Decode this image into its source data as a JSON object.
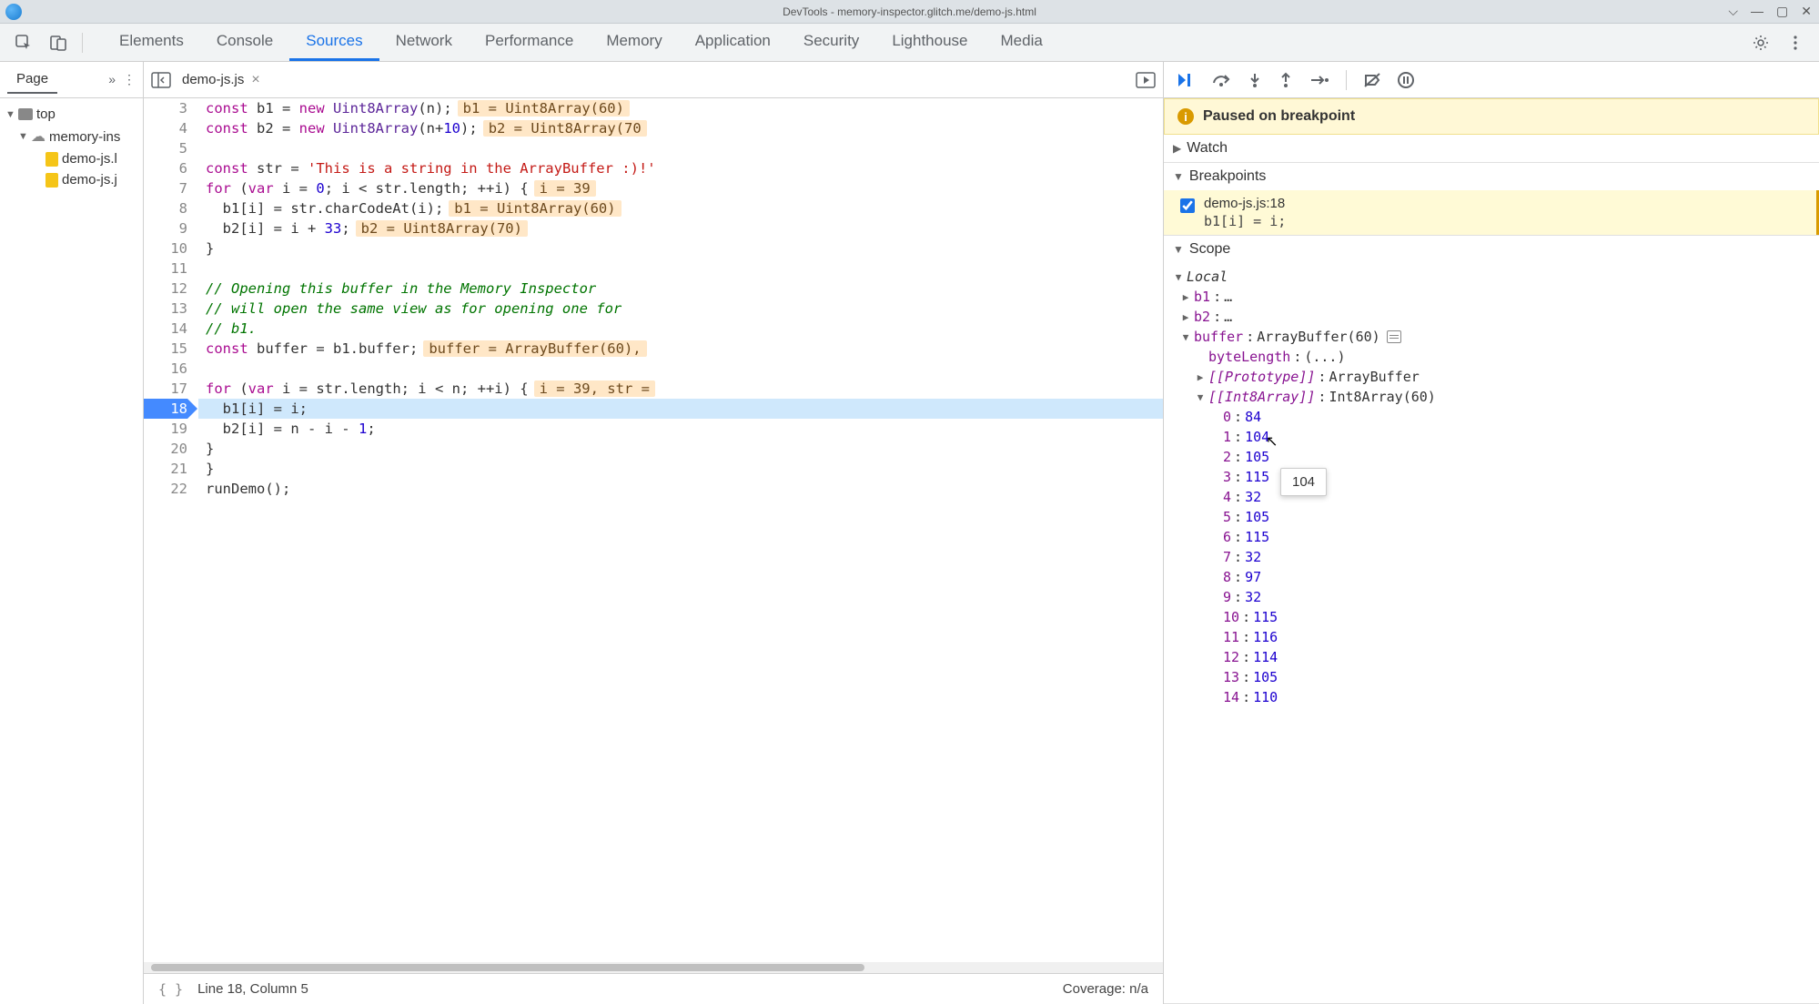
{
  "window": {
    "title": "DevTools - memory-inspector.glitch.me/demo-js.html"
  },
  "tabs": [
    "Elements",
    "Console",
    "Sources",
    "Network",
    "Performance",
    "Memory",
    "Application",
    "Security",
    "Lighthouse",
    "Media"
  ],
  "active_tab": "Sources",
  "sidebar": {
    "tab": "Page",
    "tree": {
      "top": "top",
      "domain": "memory-ins",
      "files": [
        "demo-js.l",
        "demo-js.j"
      ]
    }
  },
  "editor": {
    "filename": "demo-js.js",
    "status_line": "Line 18, Column 5",
    "coverage": "Coverage: n/a",
    "gutter_start": 3,
    "gutter_end": 22,
    "breakpoint_line": 18,
    "lines": {
      "3": {
        "html": "<span class='tok-kw'>const</span> b1 = <span class='tok-kw'>new</span> <span class='tok-type'>Uint8Array</span>(n);",
        "inline": "b1 = Uint8Array(60)"
      },
      "4": {
        "html": "<span class='tok-kw'>const</span> b2 = <span class='tok-kw'>new</span> <span class='tok-type'>Uint8Array</span>(n+<span class='tok-num'>10</span>);",
        "inline": "b2 = Uint8Array(70"
      },
      "5": {
        "html": ""
      },
      "6": {
        "html": "<span class='tok-kw'>const</span> str = <span class='tok-str'>'This is a string in the ArrayBuffer :)!'</span>"
      },
      "7": {
        "html": "<span class='tok-kw'>for</span> (<span class='tok-kw'>var</span> i = <span class='tok-num'>0</span>; i &lt; str.length; ++i) {",
        "inline": "i = 39"
      },
      "8": {
        "html": "  b1[i] = str.charCodeAt(i);",
        "inline": "b1 = Uint8Array(60)"
      },
      "9": {
        "html": "  b2[i] = i + <span class='tok-num'>33</span>;",
        "inline": "b2 = Uint8Array(70)"
      },
      "10": {
        "html": "}"
      },
      "11": {
        "html": ""
      },
      "12": {
        "html": "<span class='tok-cm'>// Opening this buffer in the Memory Inspector</span>"
      },
      "13": {
        "html": "<span class='tok-cm'>// will open the same view as for opening one for</span>"
      },
      "14": {
        "html": "<span class='tok-cm'>// b1.</span>"
      },
      "15": {
        "html": "<span class='tok-kw'>const</span> buffer = b1.buffer;",
        "inline": "buffer = ArrayBuffer(60),"
      },
      "16": {
        "html": ""
      },
      "17": {
        "html": "<span class='tok-kw'>for</span> (<span class='tok-kw'>var</span> i = str.length; i &lt; n; ++i) {",
        "inline": "i = 39, str ="
      },
      "18": {
        "html": "  b1[i] = i;",
        "hl": true
      },
      "19": {
        "html": "  b2[i] = n - i - <span class='tok-num'>1</span>;"
      },
      "20": {
        "html": "}"
      },
      "21": {
        "html": "}"
      },
      "22": {
        "html": "runDemo();"
      }
    }
  },
  "debug": {
    "pause_message": "Paused on breakpoint",
    "sections": {
      "watch": "Watch",
      "breakpoints": "Breakpoints",
      "scope": "Scope"
    },
    "breakpoint": {
      "location": "demo-js.js:18",
      "snippet": "b1[i] = i;"
    },
    "scope": {
      "local_label": "Local",
      "b1": {
        "name": "b1",
        "val": "…"
      },
      "b2": {
        "name": "b2",
        "val": "…"
      },
      "buffer": {
        "name": "buffer",
        "val": "ArrayBuffer(60)"
      },
      "byteLength": {
        "name": "byteLength",
        "val": "(...)"
      },
      "prototype": {
        "name": "[[Prototype]]",
        "val": "ArrayBuffer"
      },
      "int8array": {
        "name": "[[Int8Array]]",
        "val": "Int8Array(60)"
      },
      "array_values": [
        84,
        104,
        105,
        115,
        32,
        105,
        115,
        32,
        97,
        32,
        115,
        116,
        114,
        105,
        110
      ]
    },
    "tooltip_value": "104"
  }
}
